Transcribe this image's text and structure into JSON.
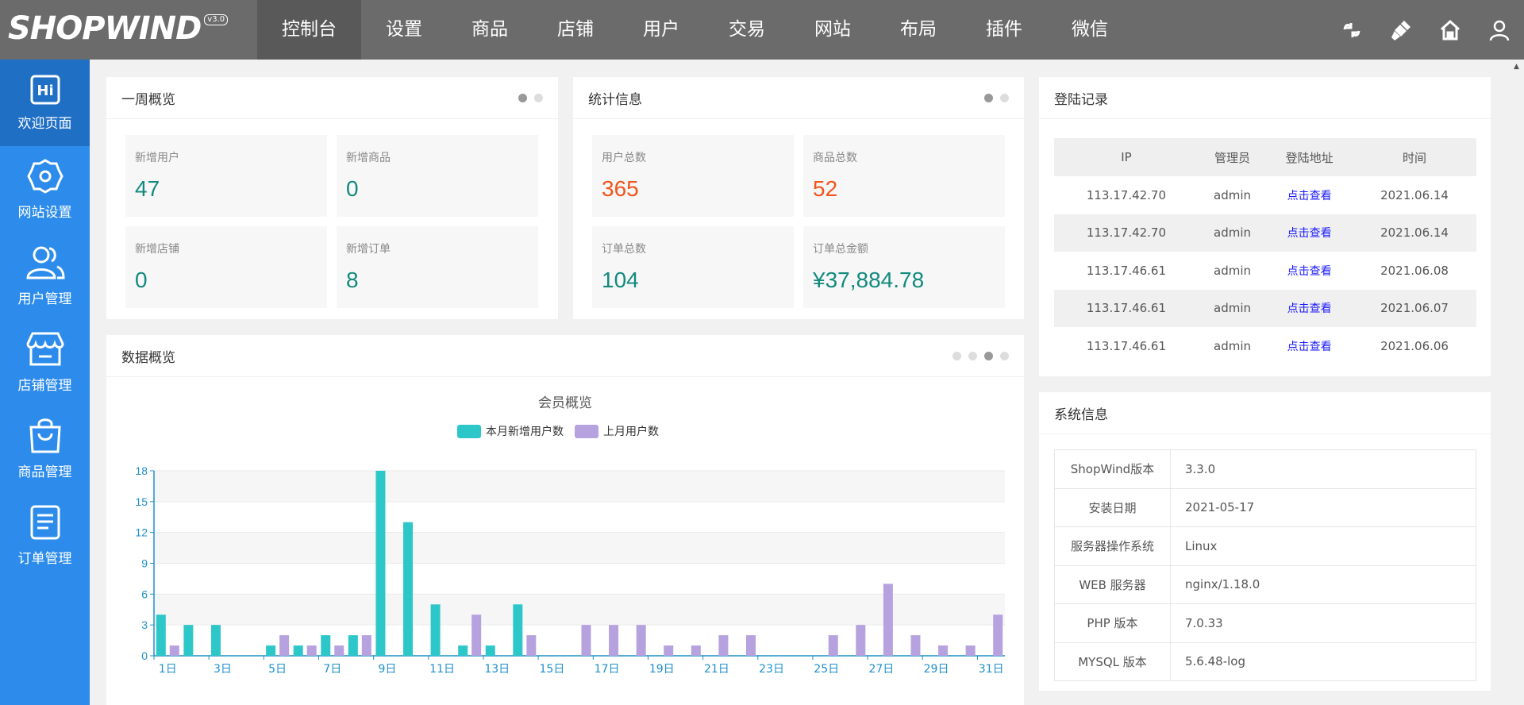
{
  "logo": {
    "text": "SHOPWIND",
    "version": "v3.0"
  },
  "nav": [
    "控制台",
    "设置",
    "商品",
    "店铺",
    "用户",
    "交易",
    "网站",
    "布局",
    "插件",
    "微信"
  ],
  "top_icons": [
    "refresh-icon",
    "brush-icon",
    "home-icon",
    "user-icon"
  ],
  "sidebar": [
    {
      "label": "欢迎页面",
      "icon": "hi-icon"
    },
    {
      "label": "网站设置",
      "icon": "gear-icon"
    },
    {
      "label": "用户管理",
      "icon": "users-icon"
    },
    {
      "label": "店铺管理",
      "icon": "store-icon"
    },
    {
      "label": "商品管理",
      "icon": "bag-icon"
    },
    {
      "label": "订单管理",
      "icon": "document-icon"
    }
  ],
  "weekly": {
    "title": "一周概览",
    "items": [
      {
        "label": "新增用户",
        "value": "47"
      },
      {
        "label": "新增商品",
        "value": "0"
      },
      {
        "label": "新增店铺",
        "value": "0"
      },
      {
        "label": "新增订单",
        "value": "8"
      }
    ]
  },
  "stats": {
    "title": "统计信息",
    "items": [
      {
        "label": "用户总数",
        "value": "365"
      },
      {
        "label": "商品总数",
        "value": "52"
      },
      {
        "label": "订单总数",
        "value": "104"
      },
      {
        "label": "订单总金额",
        "value": "¥37,884.78"
      }
    ]
  },
  "login": {
    "title": "登陆记录",
    "headers": [
      "IP",
      "管理员",
      "登陆地址",
      "时间"
    ],
    "rows": [
      {
        "ip": "113.17.42.70",
        "admin": "admin",
        "link": "点击查看",
        "time": "2021.06.14"
      },
      {
        "ip": "113.17.42.70",
        "admin": "admin",
        "link": "点击查看",
        "time": "2021.06.14"
      },
      {
        "ip": "113.17.46.61",
        "admin": "admin",
        "link": "点击查看",
        "time": "2021.06.08"
      },
      {
        "ip": "113.17.46.61",
        "admin": "admin",
        "link": "点击查看",
        "time": "2021.06.07"
      },
      {
        "ip": "113.17.46.61",
        "admin": "admin",
        "link": "点击查看",
        "time": "2021.06.06"
      }
    ]
  },
  "sysinfo": {
    "title": "系统信息",
    "rows": [
      {
        "k": "ShopWind版本",
        "v": "3.3.0"
      },
      {
        "k": "安装日期",
        "v": "2021-05-17"
      },
      {
        "k": "服务器操作系统",
        "v": "Linux"
      },
      {
        "k": "WEB 服务器",
        "v": "nginx/1.18.0"
      },
      {
        "k": "PHP 版本",
        "v": "7.0.33"
      },
      {
        "k": "MYSQL 版本",
        "v": "5.6.48-log"
      }
    ]
  },
  "overview": {
    "title": "数据概览"
  },
  "chart_data": {
    "type": "bar",
    "title": "会员概览",
    "categories": [
      "1日",
      "2日",
      "3日",
      "4日",
      "5日",
      "6日",
      "7日",
      "8日",
      "9日",
      "10日",
      "11日",
      "12日",
      "13日",
      "14日",
      "15日",
      "16日",
      "17日",
      "18日",
      "19日",
      "20日",
      "21日",
      "22日",
      "23日",
      "24日",
      "25日",
      "26日",
      "27日",
      "28日",
      "29日",
      "30日",
      "31日"
    ],
    "tick_labels": [
      "1日",
      "3日",
      "5日",
      "7日",
      "9日",
      "11日",
      "13日",
      "15日",
      "17日",
      "19日",
      "21日",
      "23日",
      "25日",
      "27日",
      "29日",
      "31日"
    ],
    "series": [
      {
        "name": "本月新增用户数",
        "color": "#2ec7c9",
        "values": [
          4,
          3,
          3,
          0,
          1,
          1,
          2,
          2,
          18,
          13,
          5,
          1,
          1,
          5,
          0,
          0,
          0,
          0,
          0,
          0,
          0,
          0,
          0,
          0,
          0,
          0,
          0,
          0,
          0,
          0,
          0
        ]
      },
      {
        "name": "上月用户数",
        "color": "#b6a2de",
        "values": [
          1,
          0,
          0,
          0,
          2,
          1,
          1,
          2,
          0,
          0,
          0,
          4,
          0,
          2,
          0,
          3,
          3,
          3,
          1,
          1,
          2,
          2,
          0,
          0,
          2,
          3,
          7,
          2,
          1,
          1,
          4
        ]
      }
    ],
    "yticks": [
      0,
      3,
      6,
      9,
      12,
      15,
      18
    ],
    "ylim": [
      0,
      18
    ],
    "grid": true,
    "legend": "top-center"
  }
}
